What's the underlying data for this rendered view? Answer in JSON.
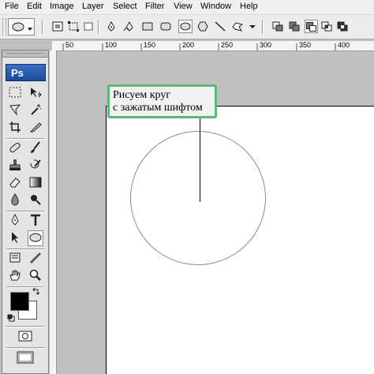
{
  "menu": [
    "File",
    "Edit",
    "Image",
    "Layer",
    "Select",
    "Filter",
    "View",
    "Window",
    "Help"
  ],
  "toolbox": {
    "logo": "Ps"
  },
  "ruler": {
    "labels": [
      "50",
      "100",
      "150",
      "200",
      "250",
      "300",
      "350",
      "400"
    ]
  },
  "callout": {
    "line1": "Рисуем круг",
    "line2": "с зажатым шифтом"
  },
  "colors": {
    "callout_border": "#5cb87a",
    "foreground": "#000000",
    "background": "#ffffff"
  },
  "options_bar_icons": [
    "ellipse-tool-preset-icon",
    "shape-layers-icon",
    "paths-icon",
    "fill-pixels-icon",
    "pen-icon",
    "freeform-pen-icon",
    "rectangle-icon",
    "rounded-rectangle-icon",
    "ellipse-icon",
    "polygon-icon",
    "line-icon",
    "custom-shape-icon",
    "dropdown-arrow-icon",
    "new-shape-area-icon",
    "add-to-shape-icon",
    "subtract-shape-icon",
    "intersect-shape-icon",
    "exclude-overlap-icon"
  ]
}
